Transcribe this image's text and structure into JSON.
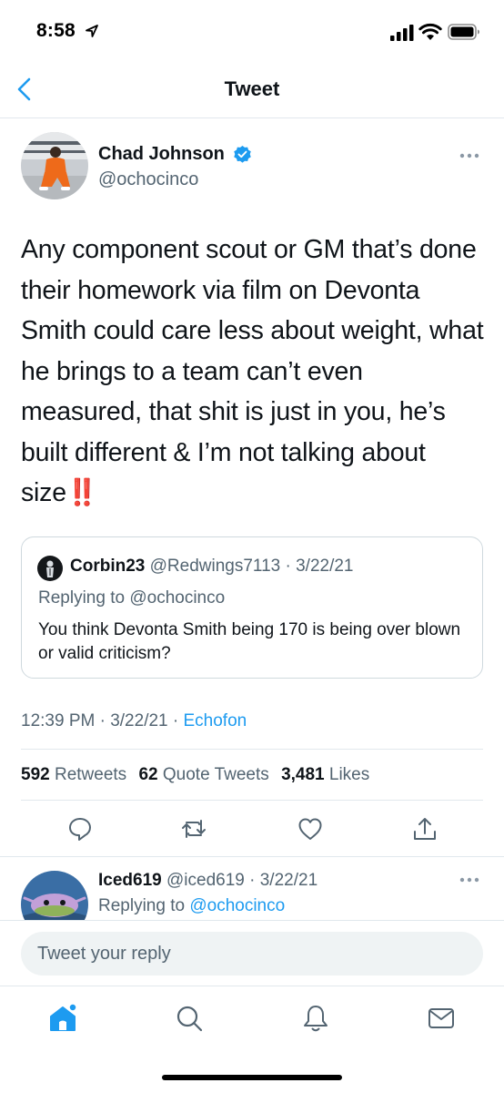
{
  "status_bar": {
    "time": "8:58"
  },
  "header": {
    "title": "Tweet"
  },
  "tweet": {
    "author_name": "Chad Johnson",
    "author_handle": "@ochocinco",
    "text": "Any component scout or GM that’s done their homework via film on Devonta Smith could care less about weight, what he brings to a team can’t even measured, that shit is just in you, he’s built different & I’m not talking about size",
    "emoji": "‼️",
    "timestamp": "12:39 PM · 3/22/21 · ",
    "source": "Echofon",
    "stats": {
      "retweets_count": "592",
      "retweets_label": "Retweets",
      "quotes_count": "62",
      "quotes_label": "Quote Tweets",
      "likes_count": "3,481",
      "likes_label": "Likes"
    }
  },
  "quoted": {
    "name": "Corbin23",
    "handle_date": "@Redwings7113 · 3/22/21",
    "replying": "Replying to @ochocinco",
    "text": "You think Devonta Smith being 170 is being over blown or valid criticism?"
  },
  "reply": {
    "name": "Iced619",
    "handle_date": "@iced619 · 3/22/21",
    "replying_prefix": "Replying to ",
    "replying_mention": "@ochocinco"
  },
  "composer": {
    "placeholder": "Tweet your reply"
  },
  "colors": {
    "accent": "#1d9bf0",
    "text": "#0f1419",
    "secondary": "#536471",
    "divider": "#e1e8ed",
    "emoji_red": "#e0191f"
  },
  "icons": {
    "status": [
      "location-arrow-icon",
      "signal-icon",
      "wifi-icon",
      "battery-icon"
    ],
    "actions": [
      "reply-icon",
      "retweet-icon",
      "like-icon",
      "share-icon"
    ],
    "tabs": [
      "home-icon",
      "search-icon",
      "notifications-icon",
      "messages-icon"
    ]
  }
}
